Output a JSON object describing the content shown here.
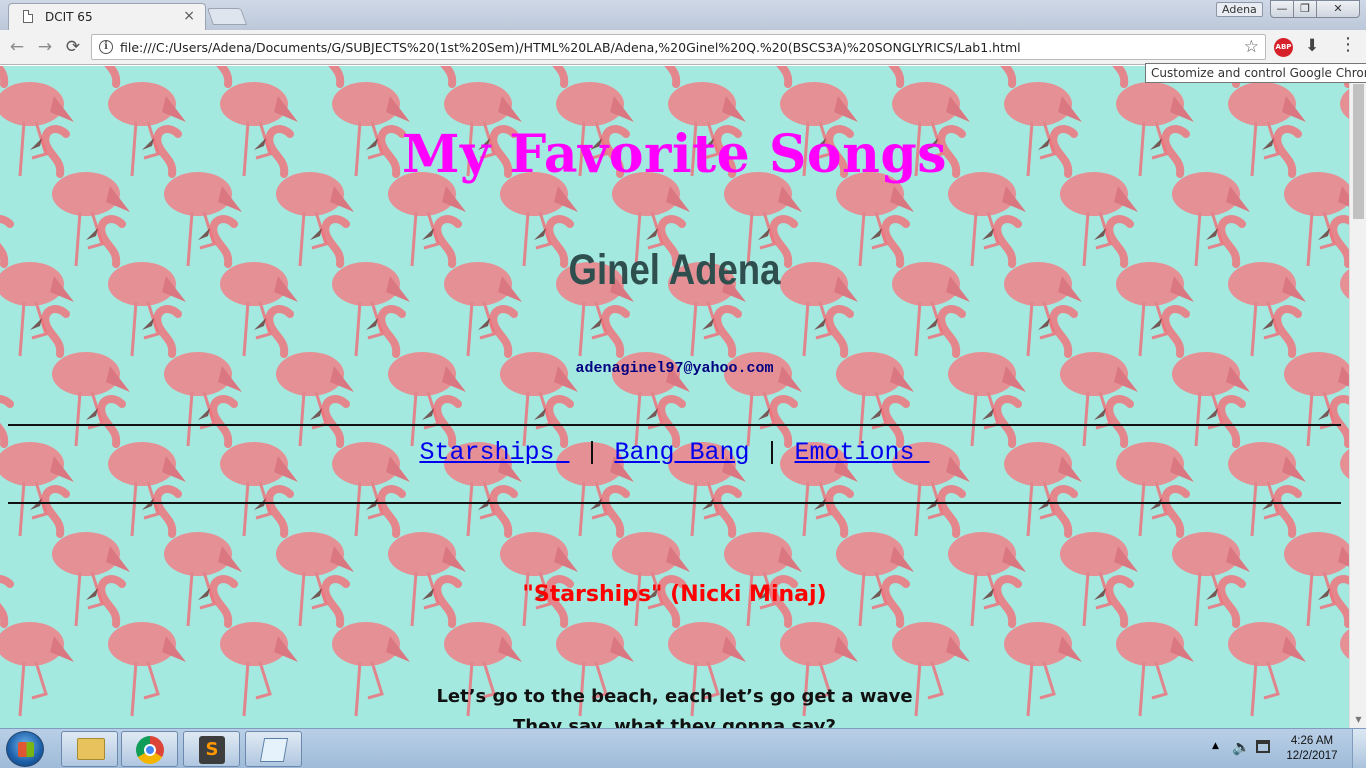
{
  "browser": {
    "tab": {
      "title": "DCIT 65",
      "close": "×"
    },
    "profile": "Adena",
    "window_buttons": {
      "minimize": "—",
      "maximize": "❐",
      "close": "✕"
    },
    "nav": {
      "back": "←",
      "forward": "→",
      "reload": "⟳"
    },
    "url": "file:///C:/Users/Adena/Documents/G/SUBJECTS%20(1st%20Sem)/HTML%20LAB/Adena,%20Ginel%20Q.%20(BSCS3A)%20SONGLYRICS/Lab1.html",
    "info_icon": "i",
    "star_icon": "☆",
    "abp_label": "ABP",
    "download_icon": "⬇",
    "menu_icon": "⋮",
    "tooltip": "Customize and control Google Chrome"
  },
  "page": {
    "title": "My Favorite Songs",
    "author": "Ginel Adena",
    "email": "adenaginel97@yahoo.com",
    "nav_links": [
      {
        "label": "Starships "
      },
      {
        "label": "Bang Bang"
      },
      {
        "label": "Emotions "
      }
    ],
    "separator": " | ",
    "song_heading": "\"Starships\" (Nicki Minaj)",
    "lyrics": [
      "Let’s go to the beach, each let’s go get a wave",
      "They say, what they gonna say?"
    ],
    "background": {
      "color": "#a4e9df",
      "motif": "flamingo"
    }
  },
  "taskbar": {
    "clock_time": "4:26 AM",
    "clock_date": "12/2/2017",
    "sublime_glyph": "S",
    "tray_arrow": "▲",
    "volume_icon": "🔈"
  },
  "colors": {
    "title": "#ff00ff",
    "author": "#2f4f4f",
    "email": "#000080",
    "link": "#0000ee",
    "song_heading": "#ff0000"
  }
}
